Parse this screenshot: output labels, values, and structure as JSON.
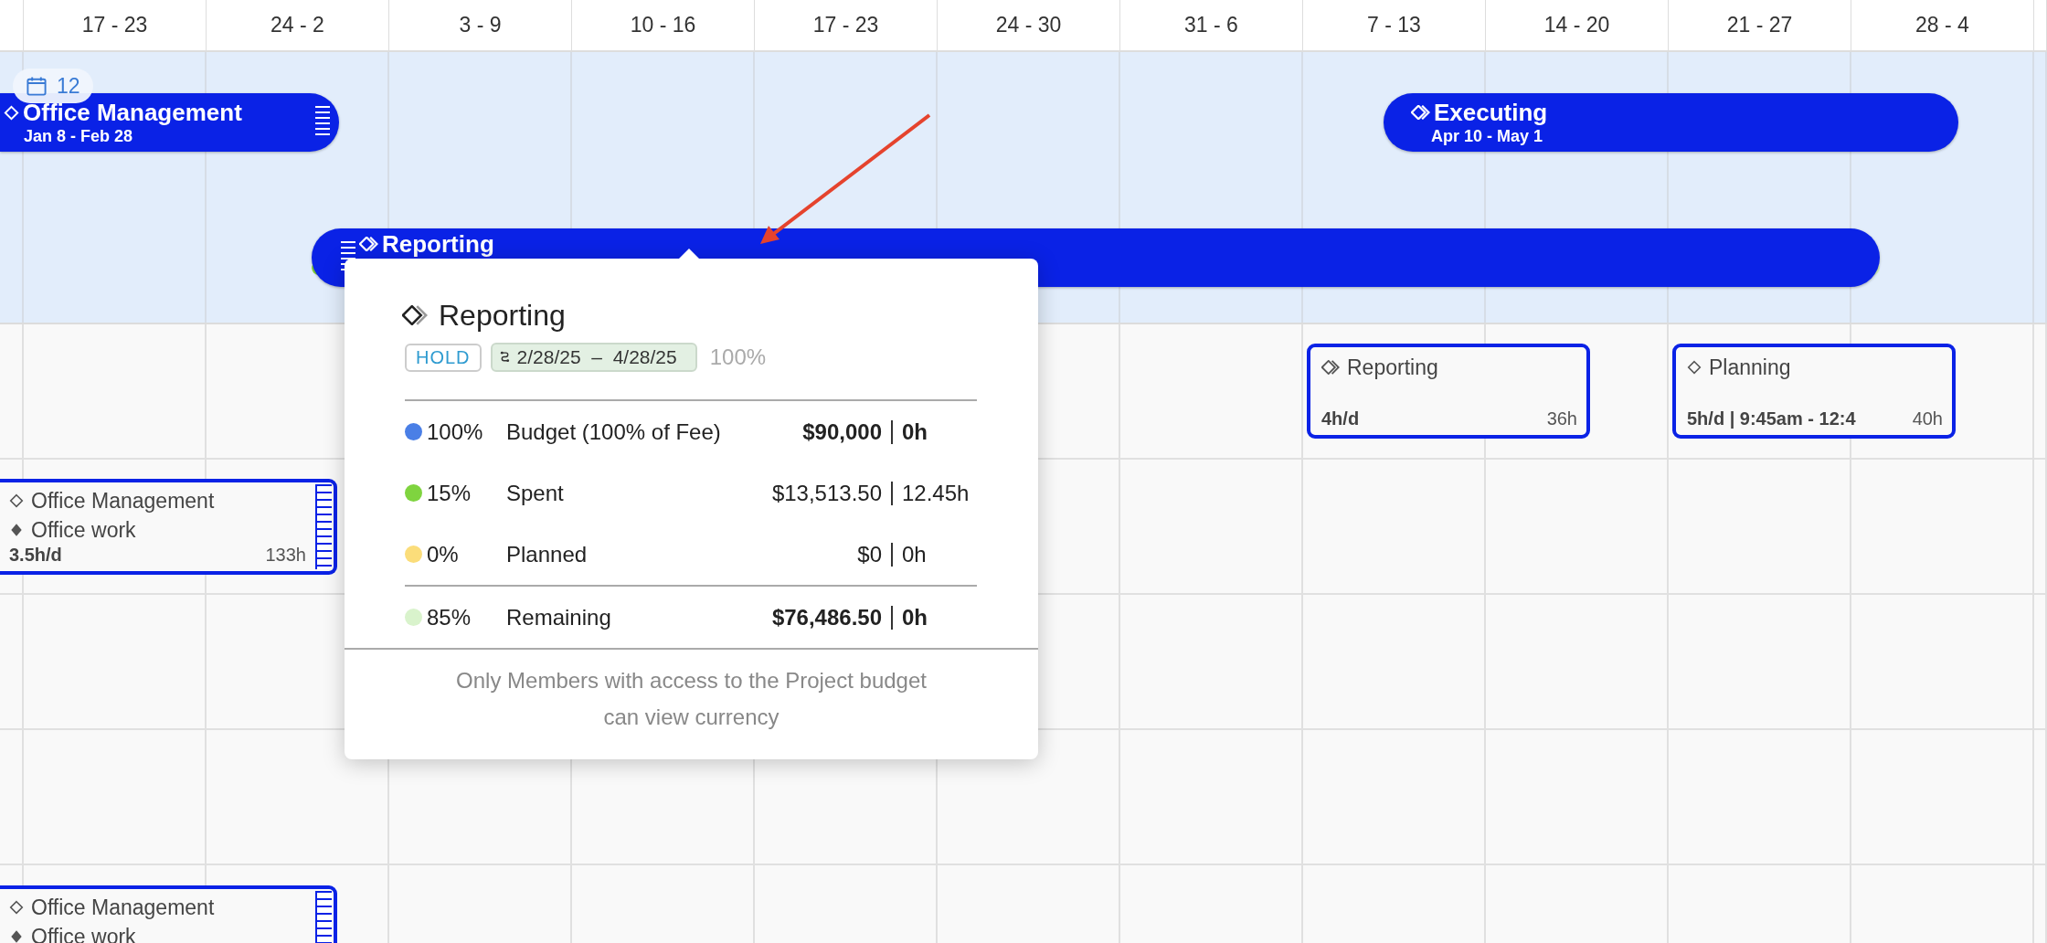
{
  "timeline": {
    "weeks": [
      "17 - 23",
      "24 - 2",
      "3 - 9",
      "10 - 16",
      "17 - 23",
      "24 - 30",
      "31 - 6",
      "7 - 13",
      "14 - 20",
      "21 - 27",
      "28 - 4"
    ]
  },
  "date_badge": {
    "text": "12"
  },
  "phases": [
    {
      "title": "Office Management",
      "dates": "Jan 8 - Feb 28"
    },
    {
      "title": "Executing",
      "dates": "Apr 10 - May 1"
    },
    {
      "title": "Reporting",
      "progress": {
        "level": 0.15
      }
    }
  ],
  "schedule_cards": [
    {
      "title": "Reporting",
      "rate": "4h/d",
      "total": "36h"
    },
    {
      "title": "Planning",
      "rate": "5h/d | 9:45am - 12:4",
      "total": "40h"
    },
    {
      "title": "Office Management",
      "subtitle": "Office work",
      "rate": "3.5h/d",
      "total": "133h"
    },
    {
      "title": "Office Management",
      "subtitle": "Office work"
    }
  ],
  "tooltip": {
    "title": "Reporting",
    "status": "HOLD",
    "dates": "2/28/25  –  4/28/25",
    "percent": "100%",
    "rows": [
      {
        "color": "#4a7fe6",
        "percent": "100%",
        "label": "Budget (100% of Fee)",
        "amount": "$90,000",
        "hours": "0h",
        "emphasis": true,
        "kind": "line"
      },
      {
        "color": "#7fd43f",
        "percent": "15%",
        "label": "Spent",
        "amount": "$13,513.50",
        "hours": "12.45h",
        "emphasis": false,
        "kind": "line"
      },
      {
        "color": "#fbdd7a",
        "percent": "0%",
        "label": "Planned",
        "amount": "$0",
        "hours": "0h",
        "emphasis": false,
        "kind": "line"
      },
      {
        "color": "#d9f3cc",
        "percent": "85%",
        "label": "Remaining",
        "amount": "$76,486.50",
        "hours": "0h",
        "emphasis": true,
        "kind": "total"
      }
    ],
    "note": "Only Members with access to the Project budget can view currency"
  }
}
